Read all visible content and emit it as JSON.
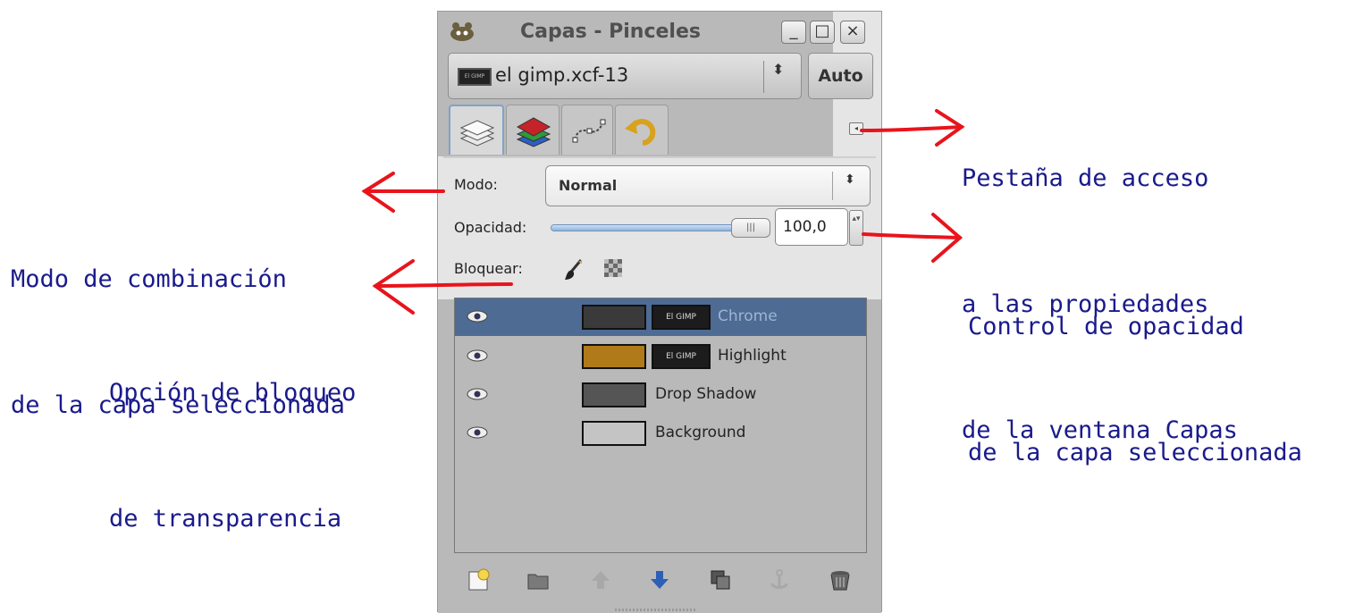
{
  "window": {
    "title": "Capas - Pinceles",
    "minimize_label": "_",
    "maximize_label": "□",
    "close_label": "×"
  },
  "image_selector": {
    "thumb_text": "El GIMP",
    "image_name": "el gimp.xcf-13",
    "arrows": "⬍",
    "auto_label": "Auto"
  },
  "tabs": [
    {
      "name": "layers",
      "icon": "layers-icon",
      "active": true
    },
    {
      "name": "channels",
      "icon": "channels-icon",
      "active": false
    },
    {
      "name": "paths",
      "icon": "paths-icon",
      "active": false
    },
    {
      "name": "undo",
      "icon": "undo-history-icon",
      "active": false
    }
  ],
  "tab_menu_icon": "◂",
  "mode": {
    "label": "Modo:",
    "value": "Normal",
    "arrows": "⬍"
  },
  "opacity": {
    "label": "Opacidad:",
    "value": "100,0",
    "fraction": 1.0,
    "handle_grip": "|||",
    "spin_arrows": "▴▾"
  },
  "lock": {
    "label": "Bloquear:",
    "icons": [
      "lock-pixels-icon",
      "lock-alpha-icon"
    ]
  },
  "layers": [
    {
      "name": "Chrome",
      "selected": true,
      "has_mask": true,
      "mask_text": "El GIMP",
      "thumb_color": "#3a3a3a"
    },
    {
      "name": "Highlight",
      "selected": false,
      "has_mask": true,
      "mask_text": "El GIMP",
      "thumb_color": "#b07a1a"
    },
    {
      "name": "Drop Shadow",
      "selected": false,
      "has_mask": false,
      "mask_text": "",
      "thumb_color": "#555555"
    },
    {
      "name": "Background",
      "selected": false,
      "has_mask": false,
      "mask_text": "",
      "thumb_color": "#c4c4c4"
    }
  ],
  "bottom_tools": [
    "new-layer-icon",
    "new-layer-group-icon",
    "raise-layer-icon",
    "lower-layer-icon",
    "duplicate-layer-icon",
    "anchor-layer-icon",
    "delete-layer-icon"
  ],
  "annotations": {
    "tab_menu": [
      "Pestaña de acceso",
      "a las propiedades",
      "de la ventana Capas"
    ],
    "mode": [
      "Modo de combinación",
      "de la capa seleccionada"
    ],
    "opacity": [
      "Control de opacidad",
      "de la capa seleccionada"
    ],
    "lock": [
      "Opción de bloqueo",
      "de transparencia"
    ]
  },
  "colors": {
    "annotation_text": "#1a1a8c",
    "arrow": "#e8141c",
    "selected_row": "#4d6b93"
  }
}
